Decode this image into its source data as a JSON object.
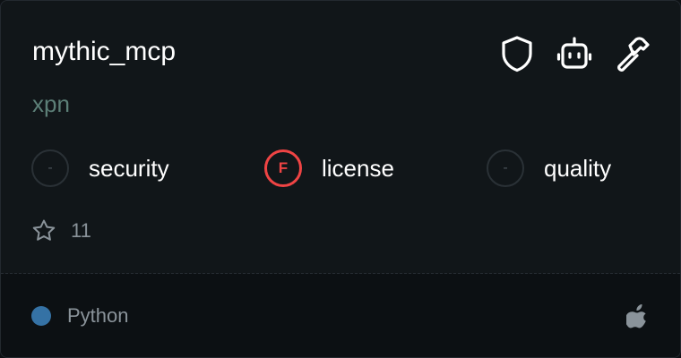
{
  "server": {
    "name": "mythic_mcp",
    "author": "xpn"
  },
  "header_icons": [
    "shield-icon",
    "robot-icon",
    "hammer-icon"
  ],
  "metrics": [
    {
      "badge": "-",
      "label": "security",
      "status": "none"
    },
    {
      "badge": "F",
      "label": "license",
      "status": "fail"
    },
    {
      "badge": "-",
      "label": "quality",
      "status": "none"
    }
  ],
  "stars": {
    "count": "11"
  },
  "footer": {
    "language": "Python",
    "language_color": "#3572A5",
    "platform_icon": "apple-icon"
  },
  "colors": {
    "background": "#111619",
    "author_text": "#5c7f77",
    "fail_red": "#ef4444"
  }
}
